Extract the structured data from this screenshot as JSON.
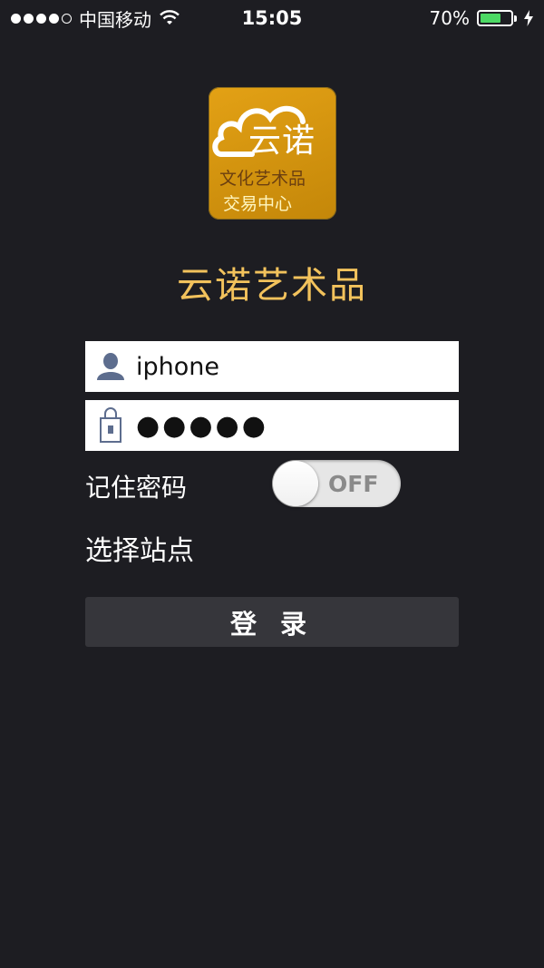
{
  "status_bar": {
    "carrier": "中国移动",
    "time": "15:05",
    "battery_percent": "70%",
    "battery_level": 0.7,
    "signal_bars_filled": 4,
    "signal_bars_total": 5
  },
  "logo": {
    "main_text": "云诺",
    "sub_line1": "文化艺术品",
    "sub_line2": "交易中心"
  },
  "app_title": "云诺艺术品",
  "login_form": {
    "username_value": "iphone",
    "password_mask": "●●●●●",
    "remember_label": "记住密码",
    "remember_toggle_text": "OFF",
    "site_select_label": "选择站点",
    "login_button_label": "登 录"
  },
  "colors": {
    "background": "#1d1d22",
    "title": "#f2c25c",
    "logo_bg": "#d9980f",
    "button_bg": "#36363b",
    "battery_fill": "#4cd964"
  },
  "icons": {
    "username_icon": "user-icon",
    "password_icon": "lock-icon"
  }
}
